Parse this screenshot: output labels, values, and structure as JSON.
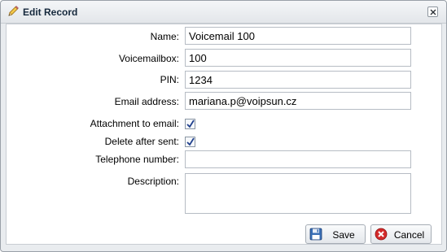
{
  "dialog": {
    "title": "Edit Record",
    "title_icon": "pencil-icon",
    "close_icon": "close-icon"
  },
  "form": {
    "name": {
      "label": "Name:",
      "value": "Voicemail 100"
    },
    "voicemailbox": {
      "label": "Voicemailbox:",
      "value": "100"
    },
    "pin": {
      "label": "PIN:",
      "value": "1234"
    },
    "email": {
      "label": "Email address:",
      "value": "mariana.p@voipsun.cz"
    },
    "attachment": {
      "label": "Attachment to email:",
      "checked": true
    },
    "delete_after_sent": {
      "label": "Delete after sent:",
      "checked": true
    },
    "telephone": {
      "label": "Telephone number:",
      "value": ""
    },
    "description": {
      "label": "Description:",
      "value": ""
    }
  },
  "buttons": {
    "save": {
      "label": "Save",
      "icon": "floppy-disk-icon"
    },
    "cancel": {
      "label": "Cancel",
      "icon": "cancel-icon"
    }
  },
  "colors": {
    "title_text": "#15283c",
    "checkmark": "#1f3f8c",
    "cancel_icon": "#d42a2a",
    "save_icon": "#3a6fb5"
  }
}
